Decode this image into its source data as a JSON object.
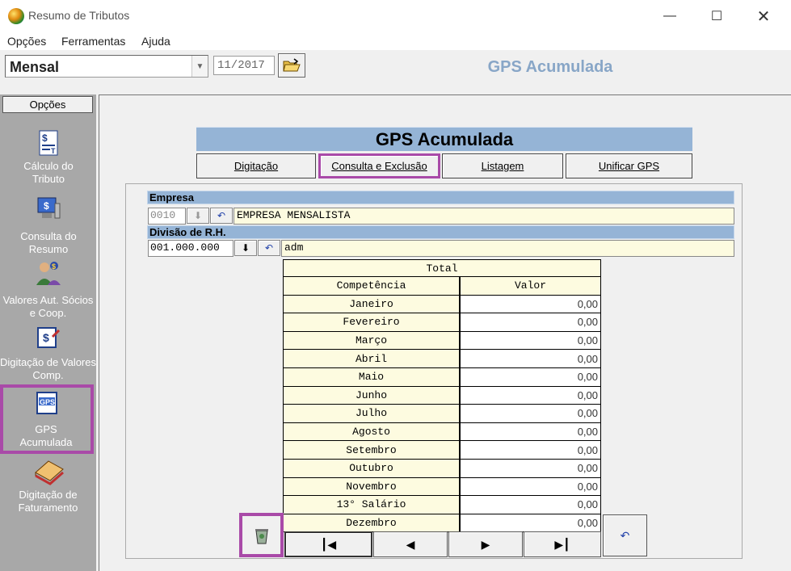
{
  "window": {
    "title": "Resumo de Tributos"
  },
  "menu": [
    "Opções",
    "Ferramentas",
    "Ajuda"
  ],
  "toolbar": {
    "mode": "Mensal",
    "period": "11/2017",
    "header_title": "GPS Acumulada"
  },
  "sidebar": {
    "heading": "Opções",
    "items": [
      {
        "label": "Cálculo do Tributo",
        "icon": "calculator-doc-icon"
      },
      {
        "label": "Consulta do Resumo",
        "icon": "computer-query-icon"
      },
      {
        "label": "Valores Aut. Sócios e Coop.",
        "icon": "users-money-icon"
      },
      {
        "label": "Digitação de Valores Comp.",
        "icon": "dollar-pen-icon"
      },
      {
        "label": "GPS Acumulada",
        "icon": "gps-doc-icon",
        "selected": true
      },
      {
        "label": "Digitação de Faturamento",
        "icon": "stack-book-icon"
      }
    ]
  },
  "panel": {
    "title": "GPS Acumulada",
    "tabs": [
      "Digitação",
      "Consulta e Exclusão",
      "Listagem",
      "Unificar GPS"
    ],
    "selected_tab": "Consulta e Exclusão"
  },
  "empresa": {
    "label": "Empresa",
    "code": "0010",
    "name": "EMPRESA MENSALISTA"
  },
  "divisao": {
    "label": "Divisão de R.H.",
    "code": "001.000.000",
    "name": "adm"
  },
  "grid": {
    "title": "Total",
    "col_month": "Competência",
    "col_value": "Valor",
    "rows": [
      {
        "month": "Janeiro",
        "value": "0,00"
      },
      {
        "month": "Fevereiro",
        "value": "0,00"
      },
      {
        "month": "Março",
        "value": "0,00"
      },
      {
        "month": "Abril",
        "value": "0,00"
      },
      {
        "month": "Maio",
        "value": "0,00"
      },
      {
        "month": "Junho",
        "value": "0,00"
      },
      {
        "month": "Julho",
        "value": "0,00"
      },
      {
        "month": "Agosto",
        "value": "0,00"
      },
      {
        "month": "Setembro",
        "value": "0,00"
      },
      {
        "month": "Outubro",
        "value": "0,00"
      },
      {
        "month": "Novembro",
        "value": "0,00"
      },
      {
        "month": "13° Salário",
        "value": "0,00"
      },
      {
        "month": "Dezembro",
        "value": "0,00"
      }
    ]
  },
  "colors": {
    "accent_blue": "#95b4d6",
    "highlight": "#a94aa8",
    "cream": "#fdfbe0"
  }
}
